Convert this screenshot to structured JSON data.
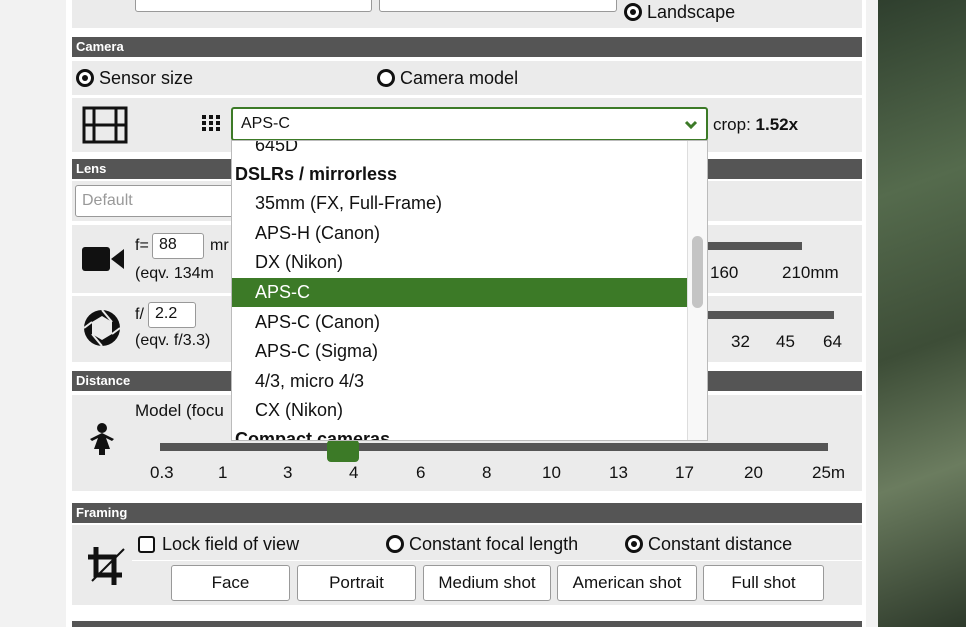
{
  "top": {
    "landscape_label": "Landscape"
  },
  "camera": {
    "header": "Camera",
    "sensor_size_label": "Sensor size",
    "camera_model_label": "Camera model",
    "select_value": "APS-C",
    "crop_prefix": "crop: ",
    "crop_value": "1.52x"
  },
  "lens": {
    "header": "Lens",
    "preset_placeholder": "Default",
    "f_prefix": "f=",
    "focal_value": "88",
    "focal_unit": "mr",
    "equiv_focal": "(eqv. 134m",
    "focal_ticks": [
      "160",
      "210mm"
    ],
    "aperture_prefix": "f/",
    "aperture_value": "2.2",
    "equiv_aperture": "(eqv. f/3.3)",
    "aperture_ticks": [
      "32",
      "45",
      "64"
    ]
  },
  "distance": {
    "header": "Distance",
    "model_label": "Model (focu",
    "slider_value": 4,
    "ticks": [
      "0.3",
      "1",
      "3",
      "4",
      "6",
      "8",
      "10",
      "13",
      "17",
      "20",
      "25m"
    ]
  },
  "framing": {
    "header": "Framing",
    "lock_fov_label": "Lock field of view",
    "lock_fov_checked": false,
    "constant_focal_label": "Constant focal length",
    "constant_distance_label": "Constant distance",
    "buttons": [
      "Face",
      "Portrait",
      "Medium shot",
      "American shot",
      "Full shot"
    ]
  },
  "dropdown": {
    "items": [
      {
        "label": "645D",
        "group": false,
        "selected": false
      },
      {
        "label": "DSLRs / mirrorless",
        "group": true,
        "selected": false
      },
      {
        "label": "35mm (FX, Full-Frame)",
        "group": false,
        "selected": false
      },
      {
        "label": "APS-H (Canon)",
        "group": false,
        "selected": false
      },
      {
        "label": "DX (Nikon)",
        "group": false,
        "selected": false
      },
      {
        "label": "APS-C",
        "group": false,
        "selected": true
      },
      {
        "label": "APS-C (Canon)",
        "group": false,
        "selected": false
      },
      {
        "label": "APS-C (Sigma)",
        "group": false,
        "selected": false
      },
      {
        "label": "4/3, micro 4/3",
        "group": false,
        "selected": false
      },
      {
        "label": "CX (Nikon)",
        "group": false,
        "selected": false
      },
      {
        "label": "Compact cameras",
        "group": true,
        "selected": false
      }
    ]
  },
  "colors": {
    "accent": "#3c7a27",
    "header_bg": "#555555",
    "row_bg": "#ebebeb"
  }
}
